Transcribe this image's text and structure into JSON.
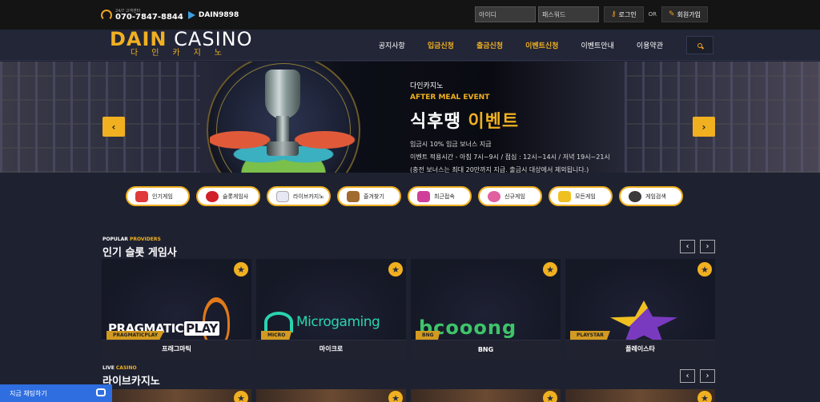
{
  "topbar": {
    "contact_label": "24/7 고객센터",
    "phone": "070-7847-8844",
    "telegram": "DAIN9898",
    "id_placeholder": "아이디",
    "pw_placeholder": "패스워드",
    "login_label": "로그인",
    "or_label": "OR",
    "signup_label": "회원가입"
  },
  "logo": {
    "main_a": "DAIN",
    "main_b": "CASINO",
    "sub": "다인카지노"
  },
  "menu": [
    {
      "label": "공지사항",
      "highlight": false
    },
    {
      "label": "입금신청",
      "highlight": true
    },
    {
      "label": "출금신청",
      "highlight": true
    },
    {
      "label": "이벤트신청",
      "highlight": true
    },
    {
      "label": "이벤트안내",
      "highlight": false
    },
    {
      "label": "이용약관",
      "highlight": false
    }
  ],
  "banner": {
    "brand": "다인카지노",
    "event": "AFTER MEAL EVENT",
    "title_white": "식후땡",
    "title_yellow": "이벤트",
    "line1": "입금시 10% 입금 보너스 지급",
    "line2": "이벤트 적용시간 - 아침 7시~9시 / 점심 : 12시~14시 / 저녁 19시~21시",
    "line3": "(충전 보너스는 최대 20만까지 지급. 출금시 대상에서 제외됩니다.)"
  },
  "categories": [
    {
      "label": "인기게임",
      "icon": "hot-icon",
      "color": "#e03a3a"
    },
    {
      "label": "슬롯게임사",
      "icon": "cherry-icon",
      "color": "#d0202a"
    },
    {
      "label": "라이브카지노",
      "icon": "dice-icon",
      "color": "#e8e8f4"
    },
    {
      "label": "즐겨찾기",
      "icon": "book-icon",
      "color": "#a06a30"
    },
    {
      "label": "최근접속",
      "icon": "clock-icon",
      "color": "#d0409a"
    },
    {
      "label": "신규게임",
      "icon": "candy-icon",
      "color": "#e060a0"
    },
    {
      "label": "모든게임",
      "icon": "gamepad-icon",
      "color": "#f0c020"
    },
    {
      "label": "게임검색",
      "icon": "magnifier-icon",
      "color": "#3a3a3a"
    }
  ],
  "providers_section": {
    "small_a": "POPULAR",
    "small_b": "PROVIDERS",
    "title": "인기 슬롯 게임사",
    "cards": [
      {
        "name": "프래그마틱",
        "tag": "PRAGMATICPLAY",
        "logo_a": "PRAGMATIC",
        "logo_b": "PLAY"
      },
      {
        "name": "마이크로",
        "tag": "MICRO",
        "logo_a": "Microgaming"
      },
      {
        "name": "BNG",
        "tag": "BNG",
        "logo_a": "bcooong"
      },
      {
        "name": "플레이스타",
        "tag": "PLAYSTAR"
      }
    ]
  },
  "live_section": {
    "small_a": "LIVE",
    "small_b": "CASINO",
    "title": "라이브카지노"
  },
  "chat": {
    "label": "지금 채팅하기"
  },
  "colors": {
    "accent": "#f0b020",
    "background": "#1e2130",
    "chat": "#2f6ee0"
  }
}
